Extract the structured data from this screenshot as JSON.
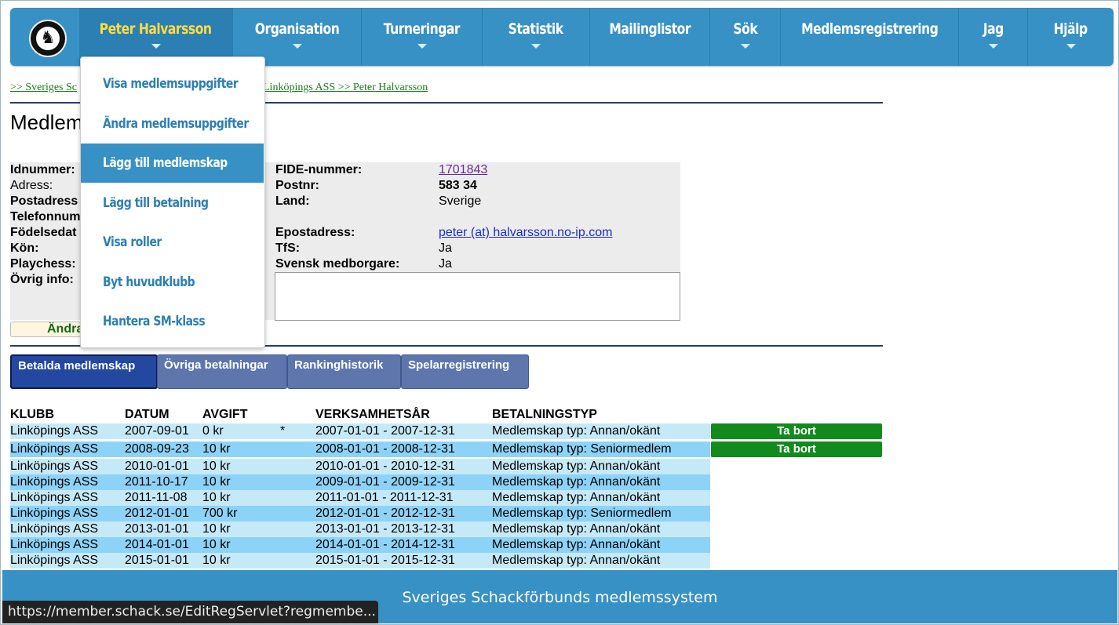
{
  "nav": {
    "items": [
      {
        "label": "Peter Halvarsson",
        "caret": true
      },
      {
        "label": "Organisation",
        "caret": true
      },
      {
        "label": "Turneringar",
        "caret": true
      },
      {
        "label": "Statistik",
        "caret": true
      },
      {
        "label": "Mailinglistor",
        "caret": false
      },
      {
        "label": "Sök",
        "caret": true
      },
      {
        "label": "Medlemsregistrering",
        "caret": false
      },
      {
        "label": "Jag",
        "caret": true
      },
      {
        "label": "Hjälp",
        "caret": true
      }
    ]
  },
  "dropdown": {
    "items": [
      "Visa medlemsuppgifter",
      "Ändra medlemsuppgifter",
      "Lägg till medlemskap",
      "Lägg till betalning",
      "Visa roller",
      "Byt huvudklubb",
      "Hantera SM-klass"
    ]
  },
  "breadcrumb": {
    "start": ">> Sveriges Sc",
    "end": "Linköpings ASS >> Peter Halvarsson"
  },
  "page": {
    "title_fragment": "Medlem"
  },
  "info": {
    "left_labels": [
      "Idnummer:",
      "Adress:",
      "Postadress",
      "Telefonnum",
      "Födelsedat",
      "Kön:",
      "Playchess:",
      "Övrig info:"
    ],
    "fide_label": "FIDE-nummer:",
    "fide_value": "1701843",
    "postnr_label": "Postnr:",
    "postnr_value": "583 34",
    "land_label": "Land:",
    "land_value": "Sverige",
    "email_label": "Epostadress:",
    "email_value": "peter (at) halvarsson.no-ip.com",
    "tfs_label": "TfS:",
    "tfs_value": "Ja",
    "citizen_label": "Svensk medborgare:",
    "citizen_value": "Ja",
    "edit_button_fragment": "Ändra"
  },
  "tabs": [
    "Betalda medlemskap",
    "Övriga betalningar",
    "Rankinghistorik",
    "Spelarregistrering"
  ],
  "table": {
    "headers": [
      "KLUBB",
      "DATUM",
      "AVGIFT",
      "VERKSAMHETSÅR",
      "BETALNINGSTYP"
    ],
    "delete_label": "Ta bort",
    "rows": [
      {
        "klubb": "Linköpings ASS",
        "datum": "2007-09-01",
        "avgift": "0 kr",
        "mark": "*",
        "ar": "2007-01-01 - 2007-12-31",
        "typ": "Medlemskap typ: Annan/okänt",
        "deletable": true
      },
      {
        "klubb": "Linköpings ASS",
        "datum": "2008-09-23",
        "avgift": "10 kr",
        "mark": "",
        "ar": "2008-01-01 - 2008-12-31",
        "typ": "Medlemskap typ: Seniormedlem",
        "deletable": true
      },
      {
        "klubb": "Linköpings ASS",
        "datum": "2010-01-01",
        "avgift": "10 kr",
        "mark": "",
        "ar": "2010-01-01 - 2010-12-31",
        "typ": "Medlemskap typ: Annan/okänt",
        "deletable": false
      },
      {
        "klubb": "Linköpings ASS",
        "datum": "2011-10-17",
        "avgift": "10 kr",
        "mark": "",
        "ar": "2009-01-01 - 2009-12-31",
        "typ": "Medlemskap typ: Annan/okänt",
        "deletable": false
      },
      {
        "klubb": "Linköpings ASS",
        "datum": "2011-11-08",
        "avgift": "10 kr",
        "mark": "",
        "ar": "2011-01-01 - 2011-12-31",
        "typ": "Medlemskap typ: Annan/okänt",
        "deletable": false
      },
      {
        "klubb": "Linköpings ASS",
        "datum": "2012-01-01",
        "avgift": "700 kr",
        "mark": "",
        "ar": "2012-01-01 - 2012-12-31",
        "typ": "Medlemskap typ: Seniormedlem",
        "deletable": false
      },
      {
        "klubb": "Linköpings ASS",
        "datum": "2013-01-01",
        "avgift": "10 kr",
        "mark": "",
        "ar": "2013-01-01 - 2013-12-31",
        "typ": "Medlemskap typ: Annan/okänt",
        "deletable": false
      },
      {
        "klubb": "Linköpings ASS",
        "datum": "2014-01-01",
        "avgift": "10 kr",
        "mark": "",
        "ar": "2014-01-01 - 2014-12-31",
        "typ": "Medlemskap typ: Annan/okänt",
        "deletable": false
      },
      {
        "klubb": "Linköpings ASS",
        "datum": "2015-01-01",
        "avgift": "10 kr",
        "mark": "",
        "ar": "2015-01-01 - 2015-12-31",
        "typ": "Medlemskap typ: Annan/okänt",
        "deletable": false
      }
    ]
  },
  "footer": {
    "text": "Sveriges Schackförbunds medlemssystem"
  },
  "statusbar": {
    "url": "https://member.schack.se/EditRegServlet?regmembe..."
  },
  "colors": {
    "nav_bg": "#3791c4",
    "active_nav_text": "#ffdd40",
    "delete_button": "#138a1e",
    "row_light": "#c6e9f7",
    "row_dark": "#8dd3f7"
  }
}
